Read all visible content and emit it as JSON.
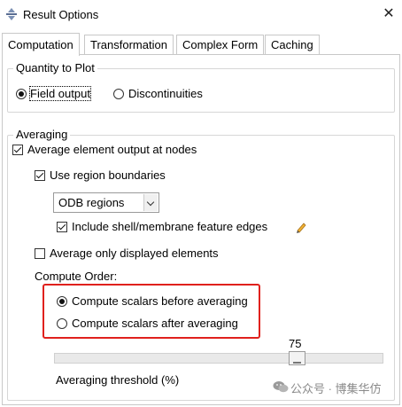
{
  "window": {
    "title": "Result Options",
    "close_glyph": "✕"
  },
  "tabs": [
    {
      "label": "Computation",
      "active": true
    },
    {
      "label": "Transformation",
      "active": false
    },
    {
      "label": "Complex Form",
      "active": false
    },
    {
      "label": "Caching",
      "active": false
    }
  ],
  "quantity": {
    "legend": "Quantity to Plot",
    "options": [
      {
        "label": "Field output",
        "selected": true
      },
      {
        "label": "Discontinuities",
        "selected": false
      }
    ]
  },
  "averaging": {
    "legend": "Averaging",
    "average_at_nodes": {
      "label": "Average element output at nodes",
      "checked": true
    },
    "use_region_boundaries": {
      "label": "Use region boundaries",
      "checked": true
    },
    "region_select": {
      "value": "ODB regions"
    },
    "include_shell": {
      "label": "Include shell/membrane feature edges",
      "checked": true,
      "icon": "pencil-icon"
    },
    "only_displayed": {
      "label": "Average only displayed elements",
      "checked": false
    },
    "compute_order_label": "Compute Order:",
    "compute_order": [
      {
        "label": "Compute scalars before averaging",
        "selected": true
      },
      {
        "label": "Compute scalars after averaging",
        "selected": false
      }
    ],
    "threshold": {
      "value_label": "75",
      "value": 75,
      "min": 0,
      "max": 100,
      "label": "Averaging threshold (%)"
    }
  },
  "annotation_color": "#e0211d",
  "watermark": {
    "text": "公众号 · 博集华仿",
    "icon": "wechat-icon"
  }
}
